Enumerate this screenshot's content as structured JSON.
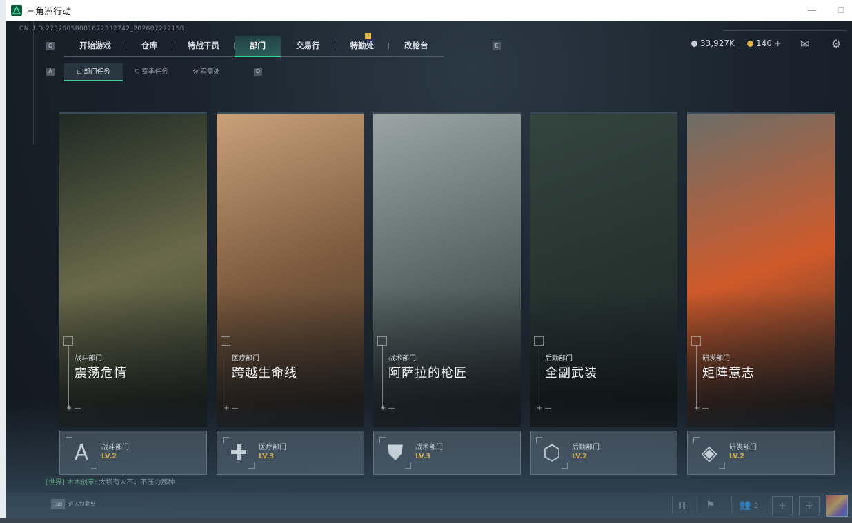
{
  "window": {
    "title": "三角洲行动",
    "minimize": "—",
    "maximize": "☐"
  },
  "uid": "CN UID:2737605880167233274​2_202607272158",
  "keys": {
    "prev_tab": "Q",
    "next_tab": "E",
    "prev_sub": "A",
    "next_sub": "D"
  },
  "tabs": [
    {
      "label": "开始游戏"
    },
    {
      "label": "仓库"
    },
    {
      "label": "特战干员"
    },
    {
      "label": "部门",
      "active": true
    },
    {
      "label": "交易行"
    },
    {
      "label": "特勤处",
      "badge": "1"
    },
    {
      "label": "改枪台"
    }
  ],
  "currency": {
    "coins": "33,927K",
    "tokens": "140 +"
  },
  "subtabs": [
    {
      "label": "部门任务",
      "icon": "task-icon",
      "glyph": "⊡",
      "active": true
    },
    {
      "label": "赛季任务",
      "icon": "season-icon",
      "glyph": "⛉"
    },
    {
      "label": "军需处",
      "icon": "supply-icon",
      "glyph": "⚒"
    }
  ],
  "departments": [
    {
      "dept": "战斗部门",
      "title": "震荡危情",
      "level": "LV.2",
      "emblem": "A",
      "colors": [
        "#1f2a24",
        "#6a6a4a",
        "#2b3328"
      ]
    },
    {
      "dept": "医疗部门",
      "title": "跨越生命线",
      "level": "LV.3",
      "emblem": "✚",
      "colors": [
        "#c8a17a",
        "#7d5b3e",
        "#3b2f26"
      ]
    },
    {
      "dept": "战术部门",
      "title": "阿萨拉的枪匠",
      "level": "LV.3",
      "emblem": "⛊",
      "colors": [
        "#9aa5a4",
        "#5a6867",
        "#262e31"
      ]
    },
    {
      "dept": "后勤部门",
      "title": "全副武装",
      "level": "LV.2",
      "emblem": "⬡",
      "colors": [
        "#34443f",
        "#263430",
        "#1b2423"
      ]
    },
    {
      "dept": "研发部门",
      "title": "矩阵意志",
      "level": "LV.2",
      "emblem": "◈",
      "colors": [
        "#6b6e68",
        "#d05a2a",
        "#2b2d2c"
      ]
    }
  ],
  "chat": {
    "channel": "[世界] 木木创意:",
    "message": " 大坝有人不。不压力那种"
  },
  "bottom": {
    "tab_key": "Tab",
    "tab_label": "进入特勤处",
    "friends": "2"
  },
  "colors": {
    "accent": "#3cd6a0",
    "level": "#f3c33a",
    "badge": "#f2c02d"
  }
}
